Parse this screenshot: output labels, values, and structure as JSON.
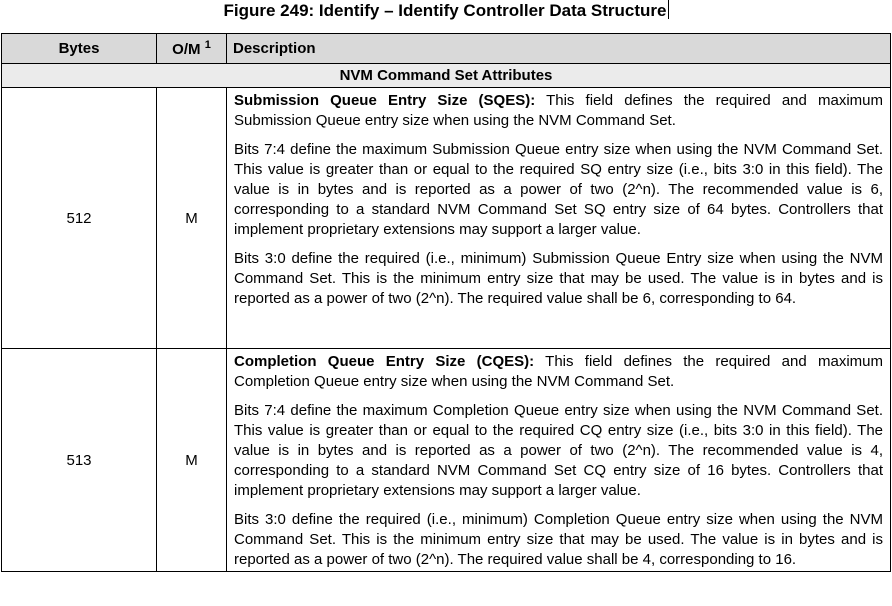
{
  "caption": "Figure 249: Identify – Identify Controller Data Structure",
  "table": {
    "headers": {
      "bytes": "Bytes",
      "om": "O/M",
      "om_footnote": "1",
      "description": "Description"
    },
    "section_title": "NVM Command Set Attributes",
    "rows": [
      {
        "bytes": "512",
        "om": "M",
        "field_name": "Submission Queue Entry Size (SQES):",
        "intro": " This field defines the required and maximum Submission Queue entry size when using the NVM Command Set.",
        "para2": "Bits 7:4 define the maximum Submission Queue entry size when using the NVM Command Set. This value is greater than or equal to the required SQ entry size (i.e., bits 3:0 in this field). The value is in bytes and is reported as a power of two (2^n). The recommended value is 6, corresponding to a standard NVM Command Set SQ entry size of 64 bytes. Controllers that implement proprietary extensions may support a larger value.",
        "para3": "Bits 3:0 define the required (i.e., minimum) Submission Queue Entry size when using the NVM Command Set. This is the minimum entry size that may be used. The value is in bytes and is reported as a power of two (2^n). The required value shall be 6, corresponding to 64."
      },
      {
        "bytes": "513",
        "om": "M",
        "field_name": "Completion Queue Entry Size (CQES):",
        "intro": " This field defines the required and maximum Completion Queue entry size when using the NVM Command Set.",
        "para2": "Bits 7:4 define the maximum Completion Queue entry size when using the NVM Command Set. This value is greater than or equal to the required CQ entry size (i.e., bits 3:0 in this field). The value is in bytes and is reported as a power of two (2^n). The recommended value is 4, corresponding to a standard NVM Command Set CQ entry size of 16 bytes. Controllers that implement proprietary extensions may support a larger value.",
        "para3": "Bits 3:0 define the required (i.e., minimum) Completion Queue entry size when using the NVM Command Set. This is the minimum entry size that may be used. The value is in bytes and is reported as a power of two (2^n). The required value shall be 4, corresponding to 16."
      }
    ]
  }
}
